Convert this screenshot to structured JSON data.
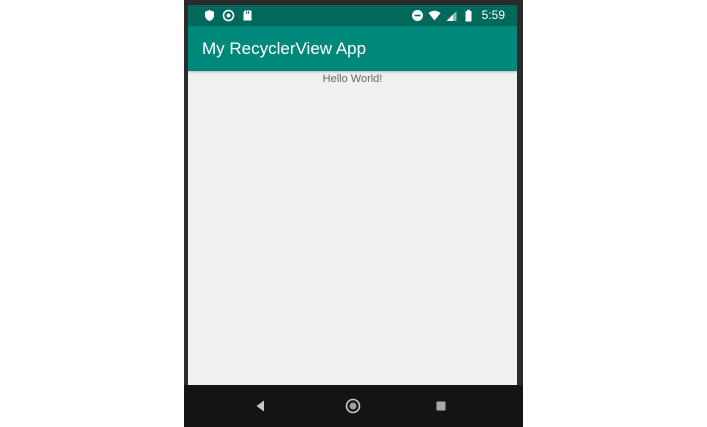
{
  "status_bar": {
    "left_icons": [
      "shield-icon",
      "settings-sync-icon",
      "sd-card-icon"
    ],
    "right_icons": [
      "do-not-disturb-icon",
      "wifi-icon",
      "cell-signal-icon",
      "battery-icon"
    ],
    "time": "5:59",
    "background_color": "#00695c"
  },
  "app_bar": {
    "title": "My RecyclerView App",
    "background_color": "#00897b"
  },
  "content": {
    "text": "Hello World!"
  },
  "nav_bar": {
    "buttons": [
      "back-icon",
      "home-icon",
      "recents-icon"
    ]
  }
}
